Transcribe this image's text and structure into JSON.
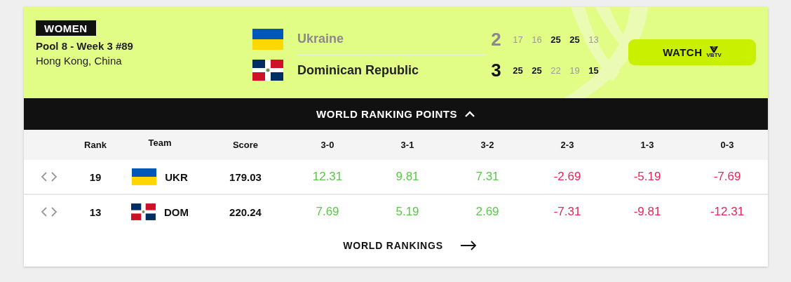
{
  "match": {
    "category": "WOMEN",
    "pool": "Pool 8 - Week 3 #89",
    "location": "Hong Kong, China",
    "teams": [
      {
        "name": "Ukraine",
        "flag": {
          "kind": "ukraine"
        },
        "winner": false,
        "sets_won": "2",
        "sets": [
          {
            "score": "17",
            "won": false
          },
          {
            "score": "16",
            "won": false
          },
          {
            "score": "25",
            "won": true
          },
          {
            "score": "25",
            "won": true
          },
          {
            "score": "13",
            "won": false
          }
        ]
      },
      {
        "name": "Dominican Republic",
        "flag": {
          "kind": "dominican"
        },
        "winner": true,
        "sets_won": "3",
        "sets": [
          {
            "score": "25",
            "won": true
          },
          {
            "score": "25",
            "won": true
          },
          {
            "score": "22",
            "won": false
          },
          {
            "score": "19",
            "won": false
          },
          {
            "score": "15",
            "won": true
          }
        ]
      }
    ],
    "watch": {
      "label": "WATCH",
      "logo_text": "VBTV"
    }
  },
  "ranking_points": {
    "title": "WORLD RANKING POINTS",
    "expanded": true,
    "columns": [
      "Rank",
      "Team",
      "Score",
      "3-0",
      "3-1",
      "3-2",
      "2-3",
      "1-3",
      "0-3"
    ],
    "rows": [
      {
        "rank": "19",
        "flag": {
          "kind": "ukraine"
        },
        "team": "UKR",
        "score": "179.03",
        "points": [
          {
            "value": "12.31",
            "kind": "gain"
          },
          {
            "value": "9.81",
            "kind": "gain"
          },
          {
            "value": "7.31",
            "kind": "gain"
          },
          {
            "value": "-2.69",
            "kind": "loss"
          },
          {
            "value": "-5.19",
            "kind": "loss"
          },
          {
            "value": "-7.69",
            "kind": "loss"
          }
        ]
      },
      {
        "rank": "13",
        "flag": {
          "kind": "dominican"
        },
        "team": "DOM",
        "score": "220.24",
        "points": [
          {
            "value": "7.69",
            "kind": "gain"
          },
          {
            "value": "5.19",
            "kind": "gain"
          },
          {
            "value": "2.69",
            "kind": "gain"
          },
          {
            "value": "-7.31",
            "kind": "loss"
          },
          {
            "value": "-9.81",
            "kind": "loss"
          },
          {
            "value": "-12.31",
            "kind": "loss"
          }
        ]
      }
    ],
    "link": "WORLD RANKINGS"
  }
}
